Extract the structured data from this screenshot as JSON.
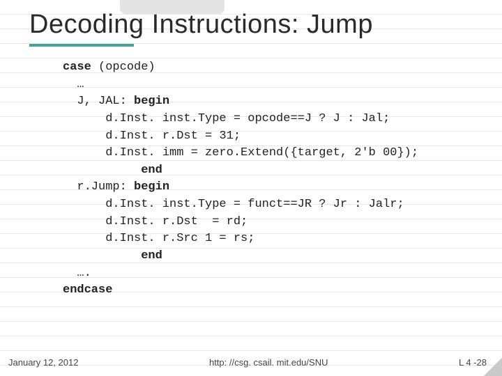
{
  "title": "Decoding Instructions: Jump",
  "code": {
    "l1a": "case",
    "l1b": " (opcode)",
    "l2": "  …",
    "l3a": "  J, JAL: ",
    "l3b": "begin",
    "l4": "      d.Inst. inst.Type = opcode==J ? J : Jal;",
    "l5": "      d.Inst. r.Dst = 31;",
    "l6": "      d.Inst. imm = zero.Extend({target, 2'b 00});",
    "l7": "           end",
    "l8a": "  r.Jump: ",
    "l8b": "begin",
    "l9": "      d.Inst. inst.Type = funct==JR ? Jr : Jalr;",
    "l10": "      d.Inst. r.Dst  = rd;",
    "l11": "      d.Inst. r.Src 1 = rs;",
    "l12": "           end",
    "l13": "  ….",
    "l14": "endcase"
  },
  "footer": {
    "date": "January 12, 2012",
    "url": "http: //csg. csail. mit.edu/SNU",
    "page": "L 4 -28"
  }
}
